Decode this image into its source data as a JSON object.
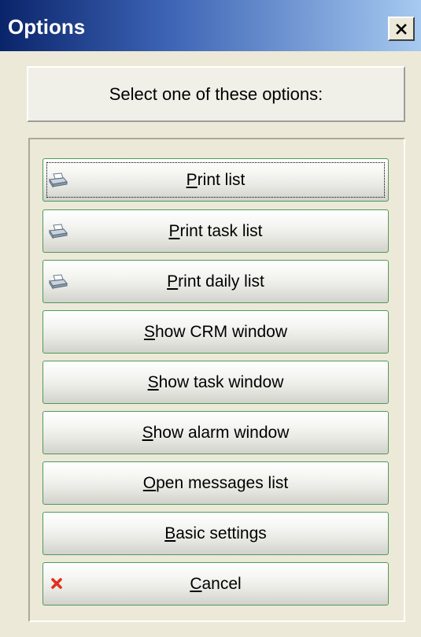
{
  "window": {
    "title": "Options"
  },
  "header": {
    "text": "Select one of these options:"
  },
  "buttons": [
    {
      "mnemonic": "P",
      "rest": "rint list",
      "icon": "printer-icon"
    },
    {
      "mnemonic": "P",
      "rest": "rint task list",
      "icon": "printer-icon"
    },
    {
      "mnemonic": "P",
      "rest": "rint daily list",
      "icon": "printer-icon"
    },
    {
      "mnemonic": "S",
      "rest": "how CRM window",
      "icon": ""
    },
    {
      "mnemonic": "S",
      "rest": "how task window",
      "icon": ""
    },
    {
      "mnemonic": "S",
      "rest": "how alarm window",
      "icon": ""
    },
    {
      "mnemonic": "O",
      "rest": "pen messages list",
      "icon": ""
    },
    {
      "mnemonic": "B",
      "rest": "asic settings",
      "icon": ""
    },
    {
      "mnemonic": "C",
      "rest": "ancel",
      "icon": "cancel-x-icon"
    }
  ],
  "colors": {
    "titlebar_start": "#0a246a",
    "titlebar_end": "#a6caf0",
    "button_border": "#4e9a5a",
    "cancel_icon": "#e0301e"
  }
}
